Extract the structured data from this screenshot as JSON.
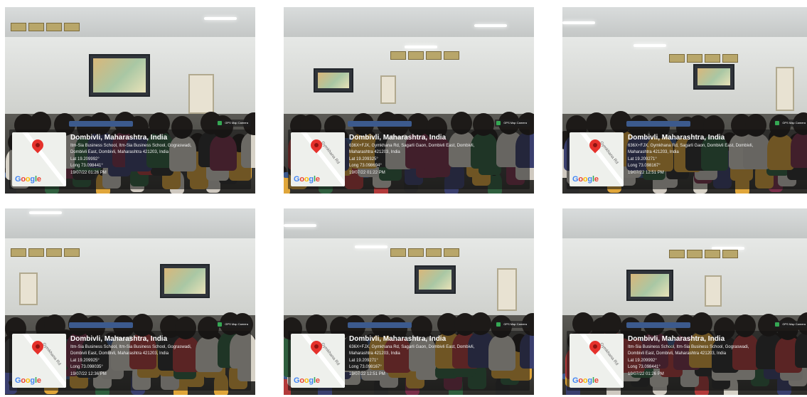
{
  "photos": [
    {
      "title": "Dombivli, Maharashtra, India",
      "address_1": "Itm-Sia Business School, Itm-Sia Business School, Gograswadi,",
      "address_2": "Dombivli East, Dombivli, Maharashtra 421203, India",
      "lat": "Lat 19.209992°",
      "long": "Long 73.098441°",
      "datetime": "19/07/22 01:26 PM",
      "map_road": "",
      "badge": "GPS Map Camera"
    },
    {
      "title": "Dombivli, Maharashtra, India",
      "address_1": "636X+FJX, Gymkhana Rd, Sagarli Gaon, Dombivli East, Dombivli,",
      "address_2": "Maharashtra 421203, India",
      "lat": "Lat 19.209325°",
      "long": "Long 73.098694°",
      "datetime": "19/07/22 01:22 PM",
      "map_road": "Gymkhana Rd",
      "badge": "GPS Map Camera"
    },
    {
      "title": "Dombivli, Maharashtra, India",
      "address_1": "636X+FJX, Gymkhana Rd, Sagarli Gaon, Dombivli East, Dombivli,",
      "address_2": "Maharashtra 421203, India",
      "lat": "Lat 19.209271°",
      "long": "Long 73.098167°",
      "datetime": "19/07/22 12:51 PM",
      "map_road": "Gymkhana Rd",
      "badge": "GPS Map Camera"
    },
    {
      "title": "Dombivli, Maharashtra, India",
      "address_1": "Itm-Sia Business School, Itm-Sia Business School, Gograswadi,",
      "address_2": "Dombivli East, Dombivli, Maharashtra 421203, India",
      "lat": "Lat 19.209925°",
      "long": "Long 73.098035°",
      "datetime": "19/07/22 12:36 PM",
      "map_road": "Gymkhana Rd",
      "badge": "GPS Map Camera"
    },
    {
      "title": "Dombivli, Maharashtra, India",
      "address_1": "636X+FJX, Gymkhana Rd, Sagarli Gaon, Dombivli East, Dombivli,",
      "address_2": "Maharashtra 421203, India",
      "lat": "Lat 19.209271°",
      "long": "Long 73.098167°",
      "datetime": "19/07/22 12:51 PM",
      "map_road": "Gymkhana Rd",
      "badge": "GPS Map Camera"
    },
    {
      "title": "Dombivli, Maharashtra, India",
      "address_1": "Itm-Sia Business School, Itm-Sia Business School, Gograswadi,",
      "address_2": "Dombivli East, Dombivli, Maharashtra 421203, India",
      "lat": "Lat 19.209992°",
      "long": "Long 73.098441°",
      "datetime": "19/07/22 01:26 PM",
      "map_road": "Gymkhana Rd",
      "badge": "GPS Map Camera"
    }
  ],
  "google_logo": "Google"
}
